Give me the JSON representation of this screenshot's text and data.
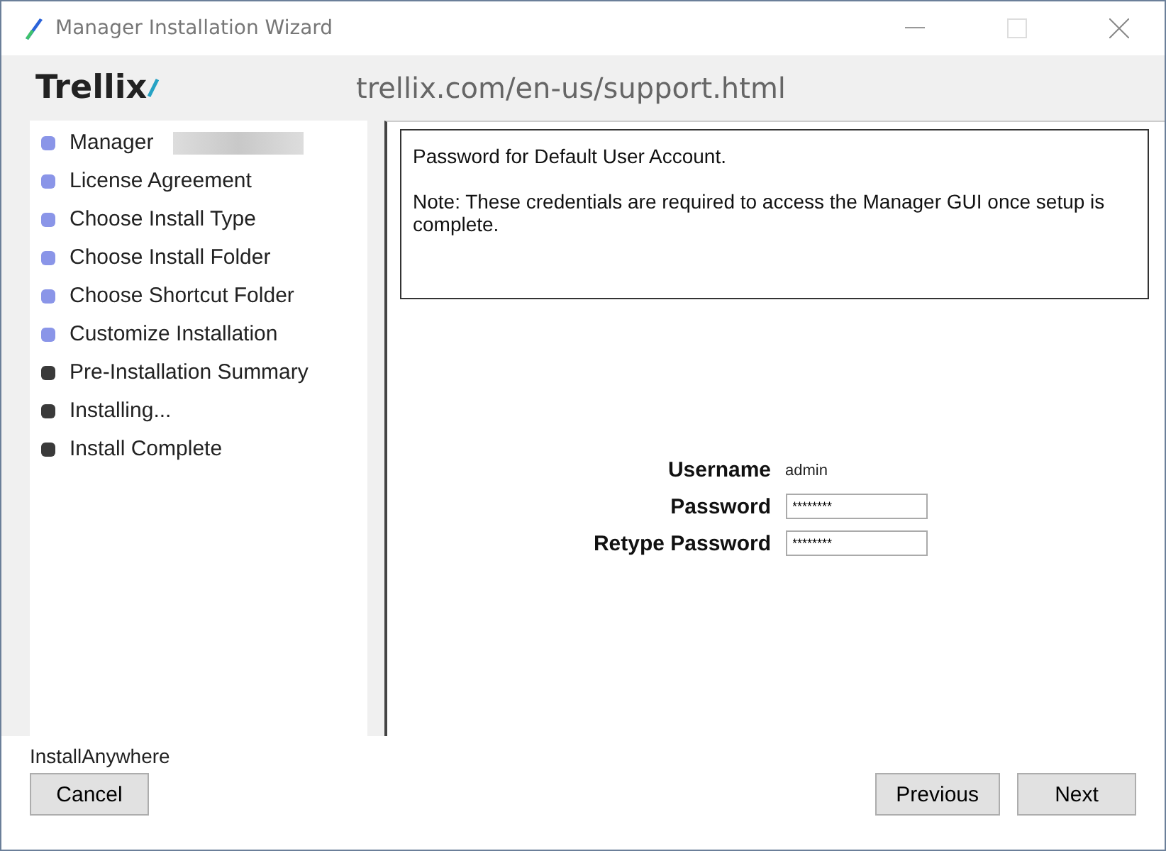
{
  "window": {
    "title": "Manager Installation Wizard"
  },
  "header": {
    "logo": "Trellix",
    "url": "trellix.com/en-us/support.html"
  },
  "steps": [
    {
      "label": "Manager",
      "redacted": true,
      "completed": true
    },
    {
      "label": "License Agreement",
      "redacted": false,
      "completed": true
    },
    {
      "label": "Choose Install Type",
      "redacted": false,
      "completed": true
    },
    {
      "label": "Choose Install Folder",
      "redacted": false,
      "completed": true
    },
    {
      "label": "Choose Shortcut Folder",
      "redacted": false,
      "completed": true
    },
    {
      "label": "Customize Installation",
      "redacted": false,
      "completed": true
    },
    {
      "label": "Pre-Installation Summary",
      "redacted": false,
      "completed": false
    },
    {
      "label": "Installing...",
      "redacted": false,
      "completed": false
    },
    {
      "label": "Install Complete",
      "redacted": false,
      "completed": false
    }
  ],
  "info": {
    "title": "Password for Default User Account.",
    "note": "Note: These credentials are required to access the Manager GUI once setup is complete."
  },
  "form": {
    "username_label": "Username",
    "username": "admin",
    "password_label": "Password",
    "password": "********",
    "retype_label": "Retype Password",
    "retype": "********"
  },
  "footer": {
    "brand": "InstallAnywhere",
    "buttons": {
      "cancel": "Cancel",
      "previous": "Previous",
      "next": "Next"
    }
  }
}
